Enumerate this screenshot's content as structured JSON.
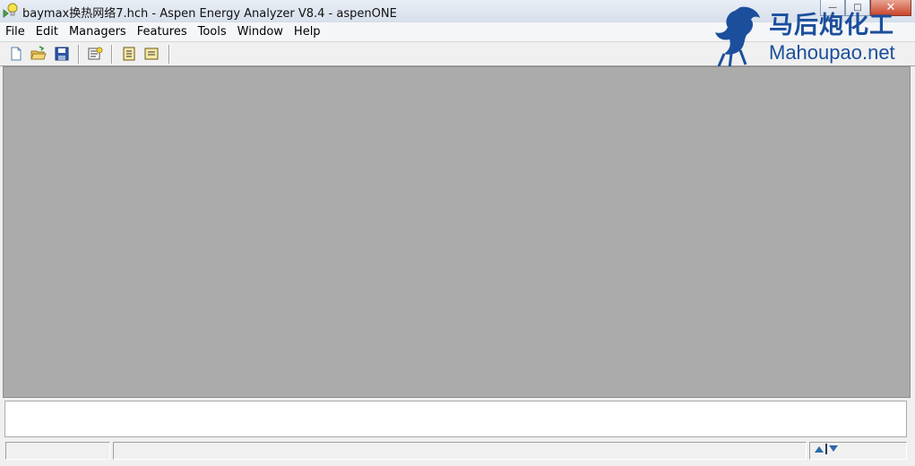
{
  "window": {
    "title": "baymax换热网络7.hch - Aspen Energy Analyzer V8.4 - aspenONE",
    "controls": {
      "minimize": "—",
      "maximize": "□",
      "close": "✕"
    }
  },
  "menu": {
    "items": [
      "File",
      "Edit",
      "Managers",
      "Features",
      "Tools",
      "Window",
      "Help"
    ]
  },
  "toolbar": {
    "buttons": [
      "new-document-icon",
      "open-folder-icon",
      "save-disk-icon",
      "properties-icon",
      "import-icon",
      "export-icon"
    ]
  },
  "watermark": {
    "cn": "马后炮化工",
    "en": "Mahoupao.net"
  },
  "colors": {
    "client_bg": "#ababab",
    "watermark": "#1b4f9c"
  }
}
